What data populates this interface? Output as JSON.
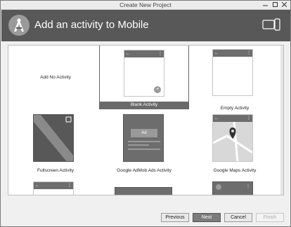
{
  "window": {
    "title": "Create New Project"
  },
  "header": {
    "heading": "Add an activity to Mobile"
  },
  "gallery": {
    "items": [
      {
        "label": "Add No Activity"
      },
      {
        "label": "Blank Activity",
        "selected": true
      },
      {
        "label": "Empty Activity"
      },
      {
        "label": "Fullscreen Activity"
      },
      {
        "label": "Google AdMob Ads Activity",
        "badge": "Ad"
      },
      {
        "label": "Google Maps Activity"
      }
    ]
  },
  "buttons": {
    "previous": "Previous",
    "next": "Next",
    "cancel": "Cancel",
    "finish": "Finish"
  },
  "colors": {
    "header": "#585858",
    "selected_label_bg": "#6a6a6a",
    "primary_button": "#7b7b7b"
  }
}
